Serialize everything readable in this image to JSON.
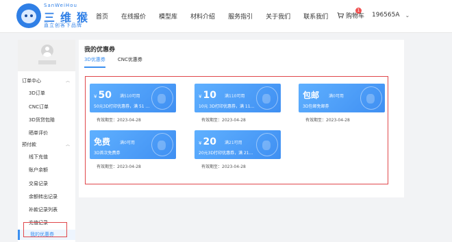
{
  "brand": {
    "name_en": "SanWeiHou",
    "name_cn": "三维猴",
    "slogan": "直立创客下品牌"
  },
  "nav": {
    "items": [
      "首页",
      "在线报价",
      "模型库",
      "材料介绍",
      "服务指引",
      "关于我们",
      "联系我们"
    ]
  },
  "cart": {
    "label": "购物车",
    "count": "1"
  },
  "user": {
    "name": "196565A"
  },
  "sidebar": {
    "groups": [
      {
        "title": "订单中心",
        "items": [
          "3D订单",
          "CNC订单",
          "3D货贷包赔",
          "晒单评价"
        ]
      },
      {
        "title": "预付款",
        "items": [
          "线下充值",
          "账户余额",
          "交易记录",
          "余额转出记录",
          "补款记录列表",
          "充值记录",
          "我的优惠券"
        ]
      }
    ]
  },
  "main": {
    "title": "我的优惠券",
    "tabs": [
      "3D优惠券",
      "CNC优惠券"
    ],
    "active_tab": "3D优惠券"
  },
  "coupons": [
    {
      "value": "50",
      "currency": "¥",
      "condition": "满510可用",
      "desc": "50元3D打印优惠券，满 51 ...",
      "expire": "有效期至：2023-04-28"
    },
    {
      "value": "10",
      "currency": "¥",
      "condition": "满110可用",
      "desc": "10元 3D打印优惠券，满 11...",
      "expire": "有效期至：2023-04-28"
    },
    {
      "value": "包邮",
      "currency": "",
      "condition": "满0可用",
      "desc": "3D包邮免邮券",
      "expire": "有效期至：2023-04-28"
    },
    {
      "value": "免费",
      "currency": "",
      "condition": "满0可用",
      "desc": "3D首次免费券",
      "expire": "有效期至：2023-04-28"
    },
    {
      "value": "20",
      "currency": "¥",
      "condition": "满21可用",
      "desc": "20元3D打印优惠券，满 21...",
      "expire": "有效期至：2023-04-28"
    }
  ],
  "colors": {
    "accent": "#3b8ff0",
    "coupon_gradient_start": "#5fb0ff",
    "coupon_gradient_end": "#3f8ff2",
    "highlight": "#e0464a"
  }
}
